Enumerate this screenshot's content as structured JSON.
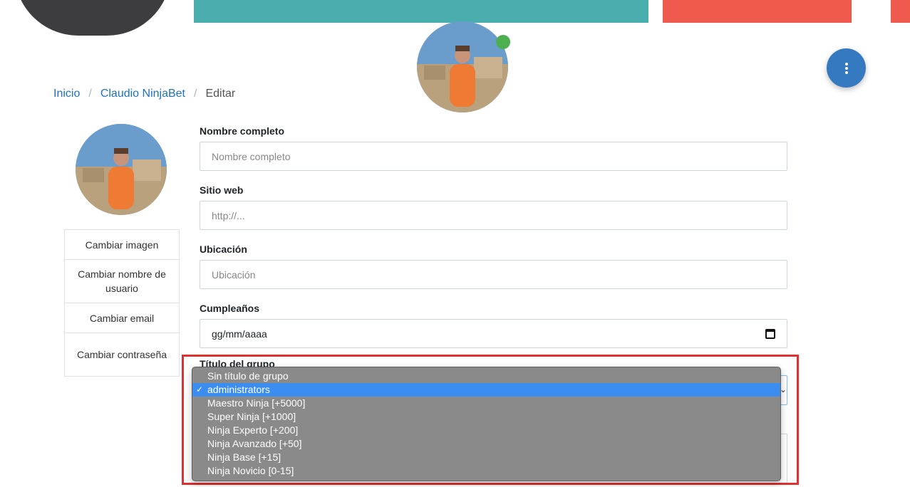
{
  "breadcrumb": {
    "home": "Inicio",
    "user": "Claudio NinjaBet",
    "current": "Editar"
  },
  "side_menu": [
    "Cambiar imagen",
    "Cambiar nombre de usuario",
    "Cambiar email",
    "Cambiar contraseña"
  ],
  "form": {
    "fullname_label": "Nombre completo",
    "fullname_placeholder": "Nombre completo",
    "website_label": "Sitio web",
    "website_placeholder": "http://...",
    "location_label": "Ubicación",
    "location_placeholder": "Ubicación",
    "birthday_label": "Cumpleaños",
    "birthday_value": "gg/mm/aaaa",
    "group_label": "Título del grupo"
  },
  "group_select": {
    "options": [
      "Sin título de grupo",
      "administrators",
      "Maestro Ninja [+5000]",
      "Super Ninja [+1000]",
      "Ninja Experto [+200]",
      "Ninja Avanzado [+50]",
      "Ninja Base [+15]",
      "Ninja Novicio [0-15]"
    ],
    "selected": "administrators",
    "check_mark": "✓"
  },
  "colors": {
    "accent": "#3579c0",
    "highlight": "#e03131",
    "online": "#4caf50",
    "dropdown_bg": "#8a8a8a",
    "selected_bg": "#3b8ef0"
  }
}
